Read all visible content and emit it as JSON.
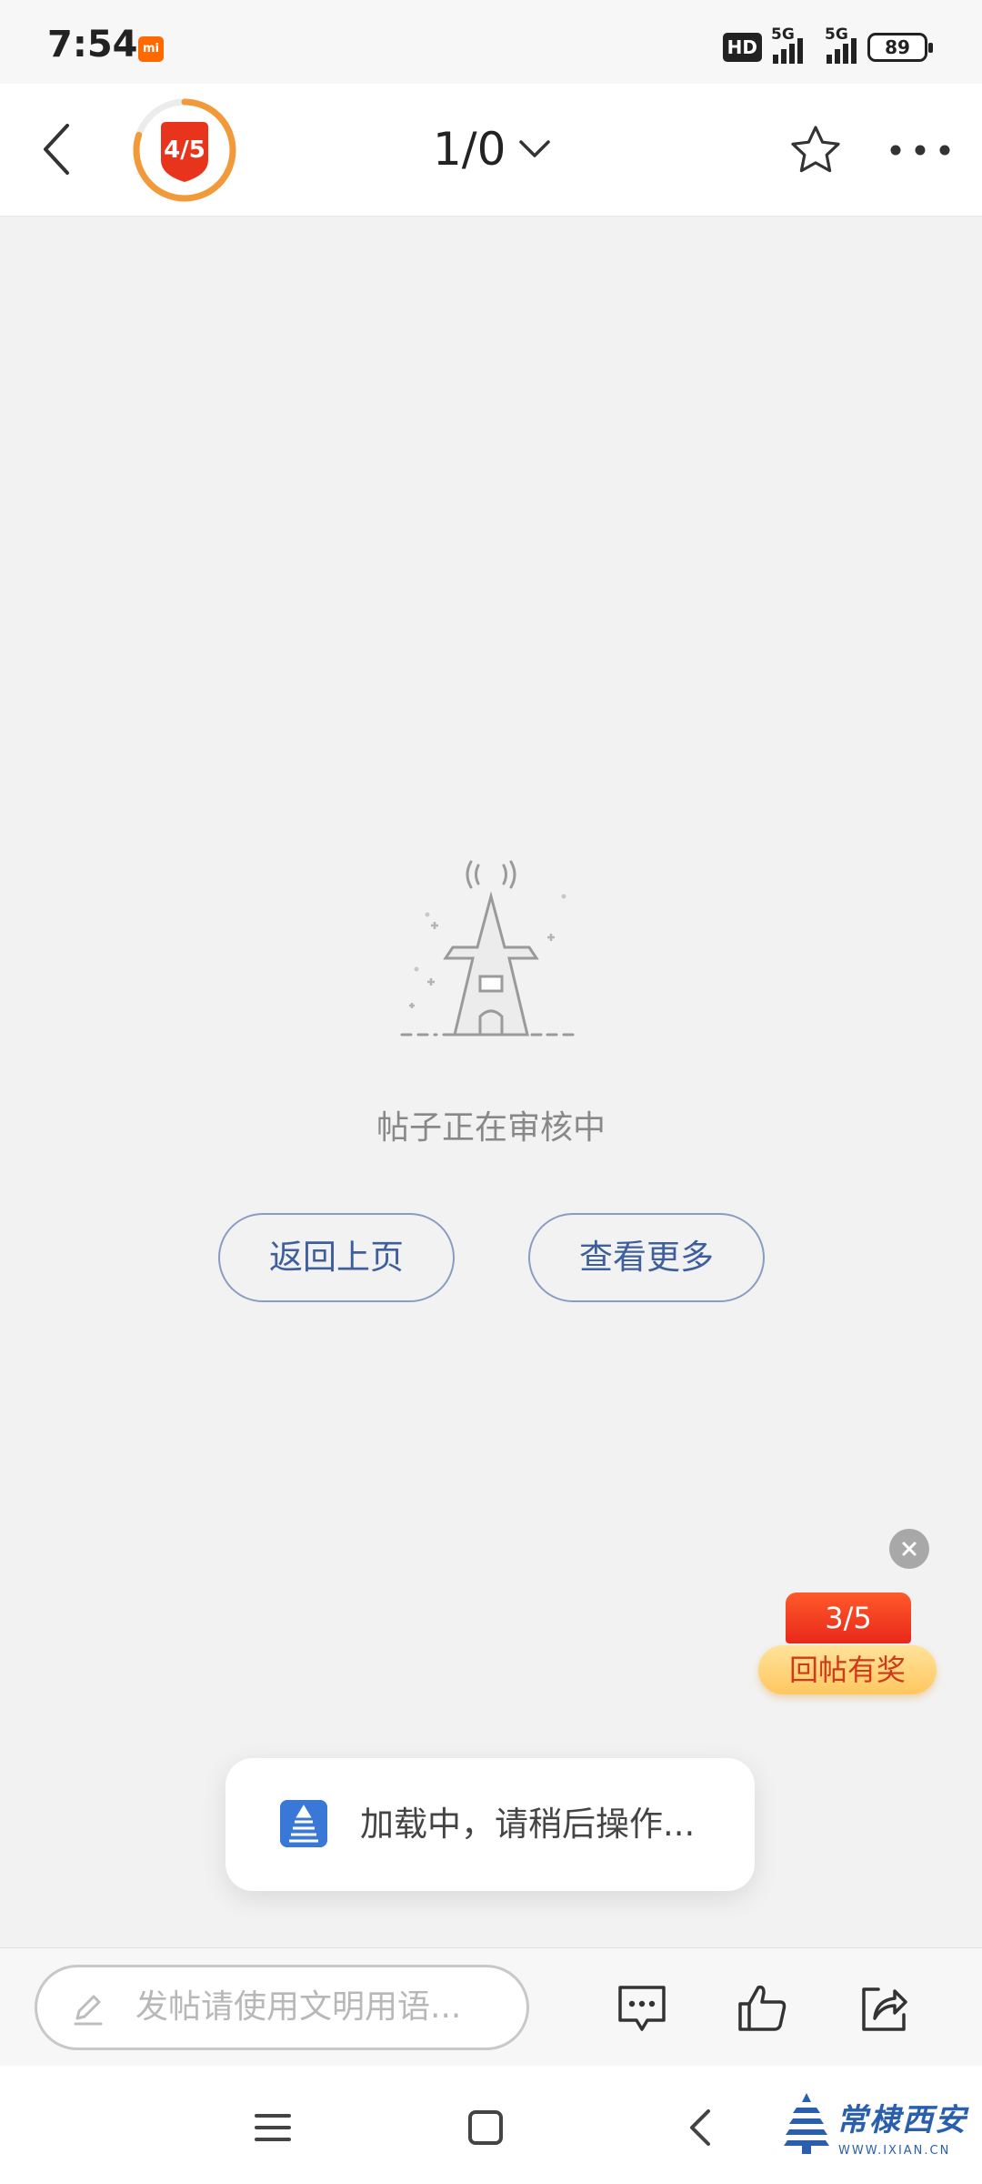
{
  "status_bar": {
    "time": "7:54",
    "hd_label": "HD",
    "network_1": "5G",
    "network_2": "5G",
    "battery": "89"
  },
  "header": {
    "progress_label": "4/5",
    "progress_fraction": 0.8,
    "page_indicator": "1/0",
    "accent": "#f29a3a",
    "badge_color": "#e8341c"
  },
  "empty_state": {
    "message": "帖子正在审核中",
    "back_label": "返回上页",
    "more_label": "查看更多"
  },
  "reward": {
    "count": "3/5",
    "label": "回帖有奖"
  },
  "toast": {
    "text": "加载中，请稍后操作..."
  },
  "bottom_bar": {
    "placeholder": "发帖请使用文明用语..."
  },
  "watermark": {
    "title": "常棣西安",
    "url": "WWW.IXIAN.CN"
  },
  "icons": [
    "back-icon",
    "star-icon",
    "more-icon",
    "close-icon",
    "pen-icon",
    "comment-icon",
    "like-icon",
    "share-icon",
    "menu-icon",
    "home-icon",
    "nav-back-icon"
  ]
}
